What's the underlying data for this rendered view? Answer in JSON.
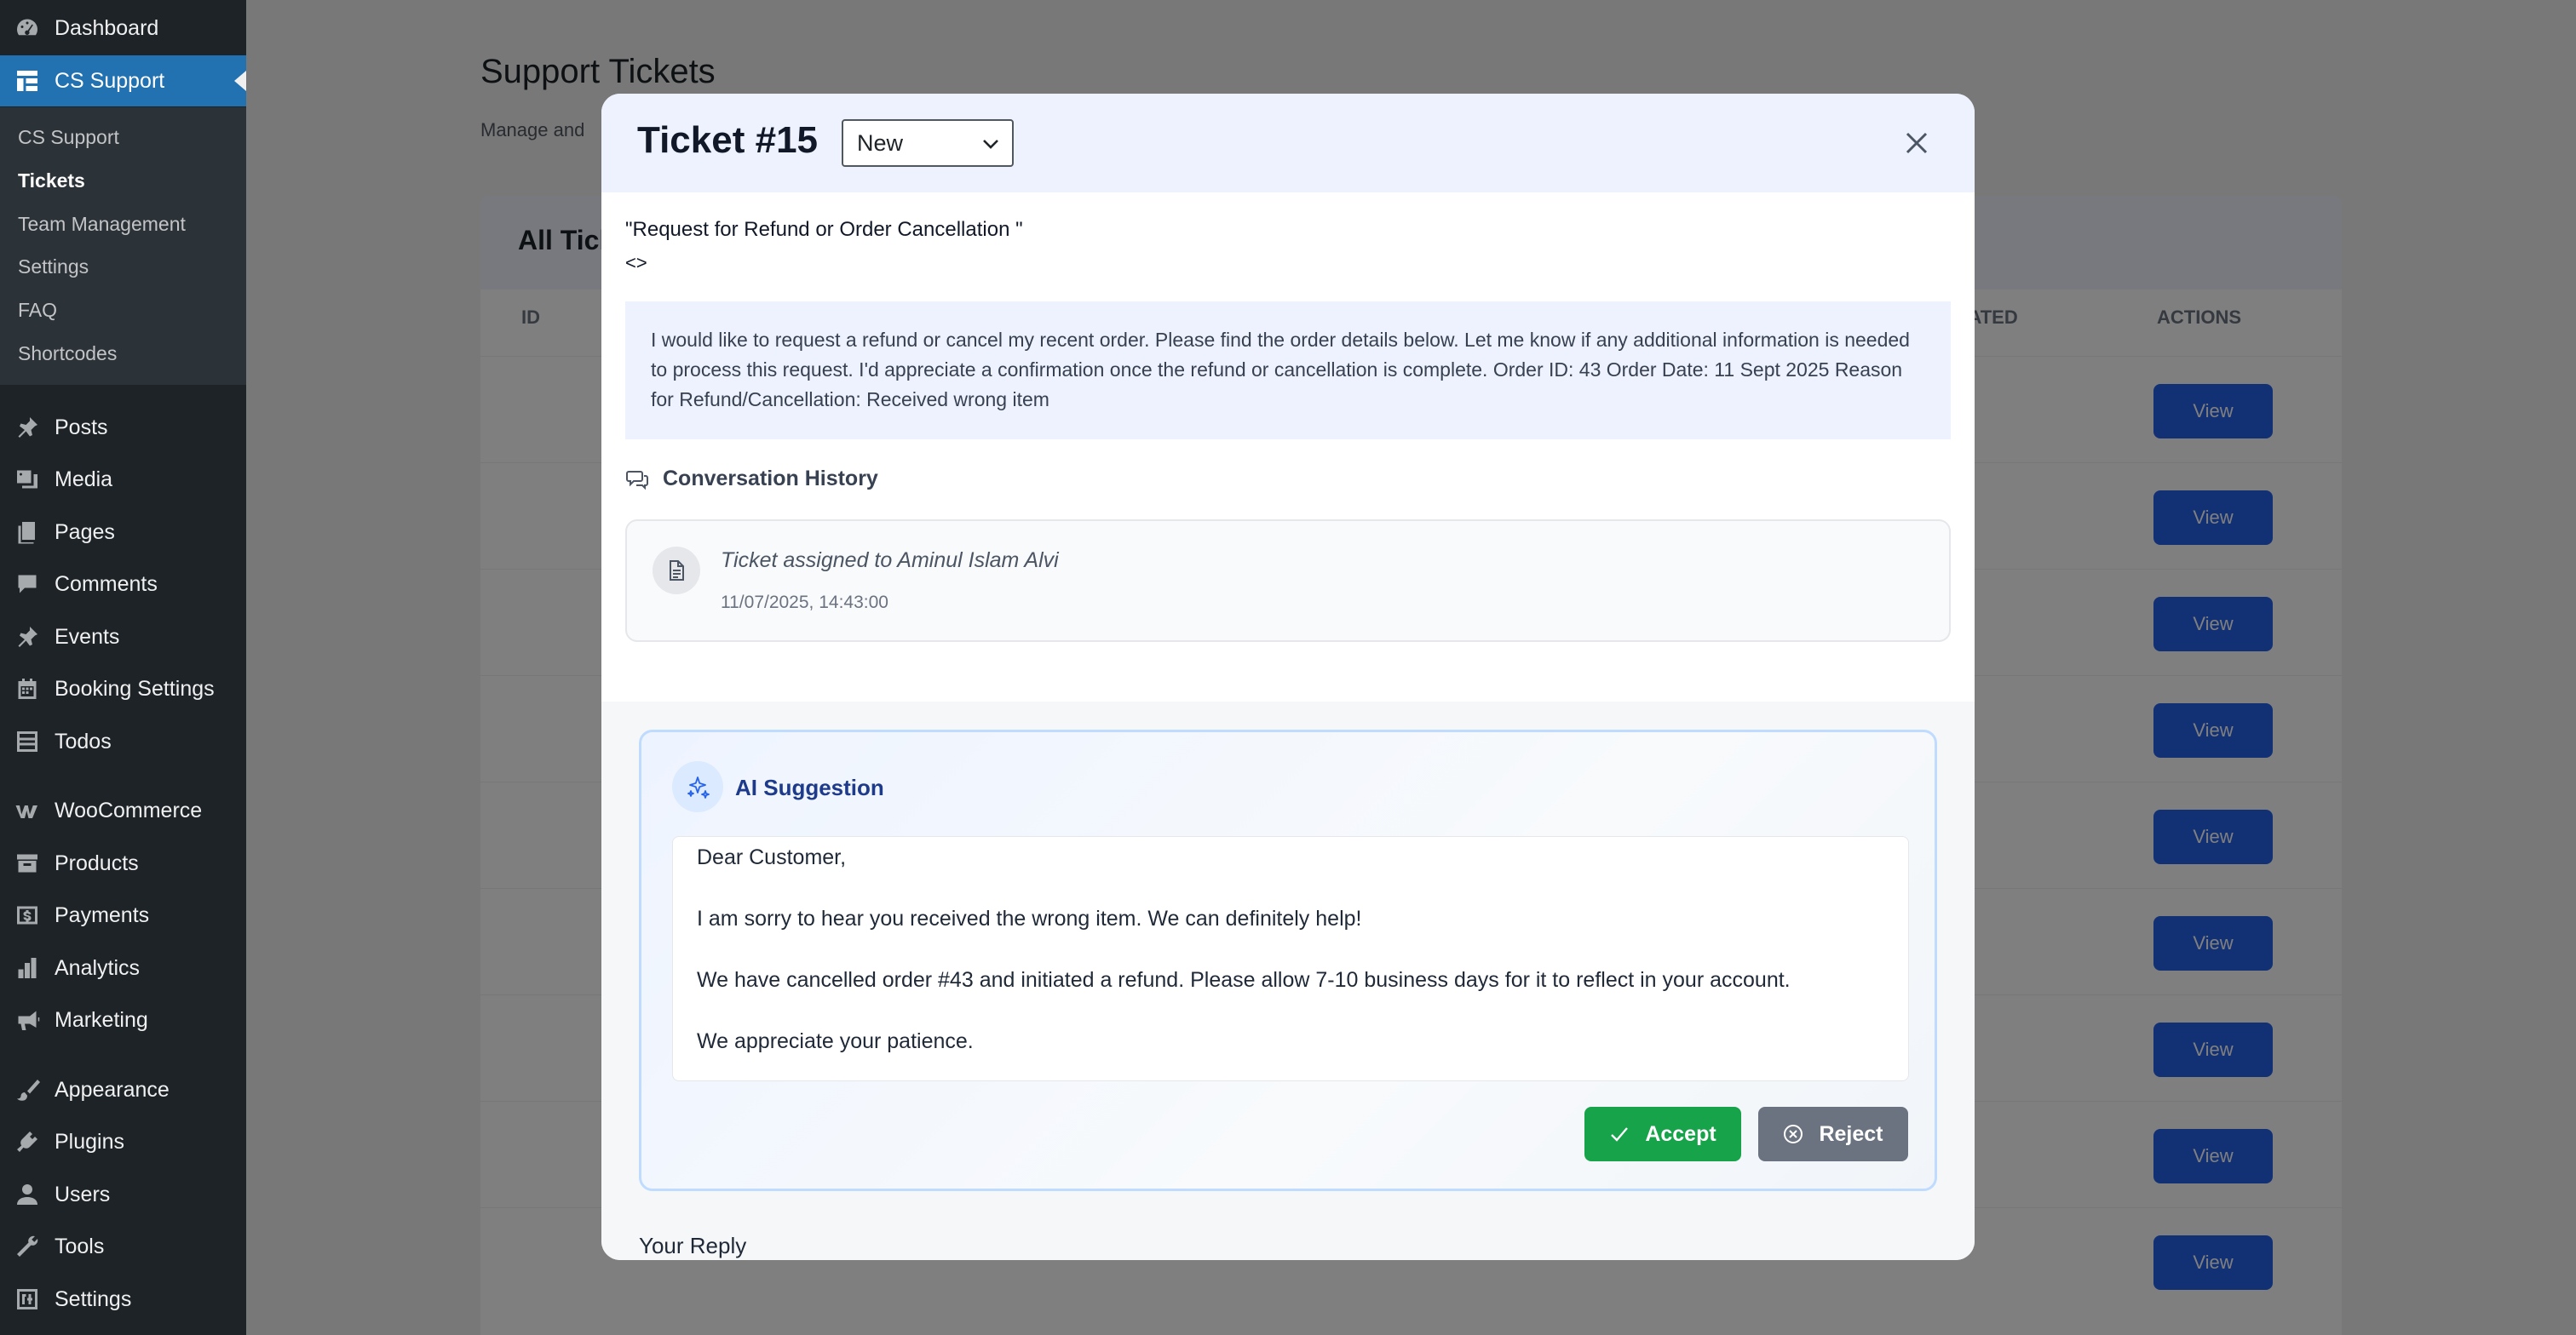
{
  "sidebar": {
    "items": [
      {
        "label": "Dashboard",
        "icon": "dashboard-icon"
      },
      {
        "label": "CS Support",
        "icon": "grid-icon",
        "active": true
      },
      {
        "label": "Posts",
        "icon": "pin-icon"
      },
      {
        "label": "Media",
        "icon": "media-icon"
      },
      {
        "label": "Pages",
        "icon": "pages-icon"
      },
      {
        "label": "Comments",
        "icon": "comment-icon"
      },
      {
        "label": "Events",
        "icon": "pin-icon"
      },
      {
        "label": "Booking Settings",
        "icon": "calendar-icon"
      },
      {
        "label": "Todos",
        "icon": "list-icon"
      },
      {
        "label": "WooCommerce",
        "icon": "woo-icon"
      },
      {
        "label": "Products",
        "icon": "archive-icon"
      },
      {
        "label": "Payments",
        "icon": "dollar-icon"
      },
      {
        "label": "Analytics",
        "icon": "bar-chart-icon"
      },
      {
        "label": "Marketing",
        "icon": "megaphone-icon"
      },
      {
        "label": "Appearance",
        "icon": "brush-icon"
      },
      {
        "label": "Plugins",
        "icon": "plug-icon"
      },
      {
        "label": "Users",
        "icon": "user-icon"
      },
      {
        "label": "Tools",
        "icon": "wrench-icon"
      },
      {
        "label": "Settings",
        "icon": "settings-icon"
      }
    ],
    "submenu": [
      {
        "label": "CS Support"
      },
      {
        "label": "Tickets",
        "current": true
      },
      {
        "label": "Team Management"
      },
      {
        "label": "Settings"
      },
      {
        "label": "FAQ"
      },
      {
        "label": "Shortcodes"
      }
    ]
  },
  "background_page": {
    "title": "Support Tickets",
    "subtitle": "Manage and",
    "card_title": "All Tickets",
    "columns": [
      "ID",
      "CREATED",
      "ACTIONS"
    ],
    "row_button": "View"
  },
  "modal": {
    "title": "Ticket #15",
    "status": "New",
    "subject": "\"Request for Refund or Order Cancellation \"",
    "subject_meta": "<>",
    "message": "I would like to request a refund or cancel my recent order. Please find the order details below. Let me know if any additional information is needed to process this request. I'd appreciate a confirmation once the refund or cancellation is complete. Order ID: 43 Order Date: 11 Sept 2025 Reason for Refund/Cancellation: Received wrong item",
    "conversation_title": "Conversation History",
    "history": [
      {
        "text": "Ticket assigned to Aminul Islam Alvi",
        "time": "11/07/2025, 14:43:00"
      }
    ],
    "ai": {
      "title": "AI Suggestion",
      "text": "Dear Customer,\n\nI am sorry to hear you received the wrong item. We can definitely help!\n\nWe have cancelled order #43 and initiated a refund. Please allow 7-10 business days for it to reflect in your account.\n\nWe appreciate your patience.",
      "accept_label": "Accept",
      "reject_label": "Reject"
    },
    "reply_label": "Your Reply"
  },
  "colors": {
    "sidebar_bg": "#1d2327",
    "active_menu": "#2271b1",
    "accept": "#16a34a",
    "reject": "#6b7280",
    "ai_title": "#1e3a8a"
  }
}
